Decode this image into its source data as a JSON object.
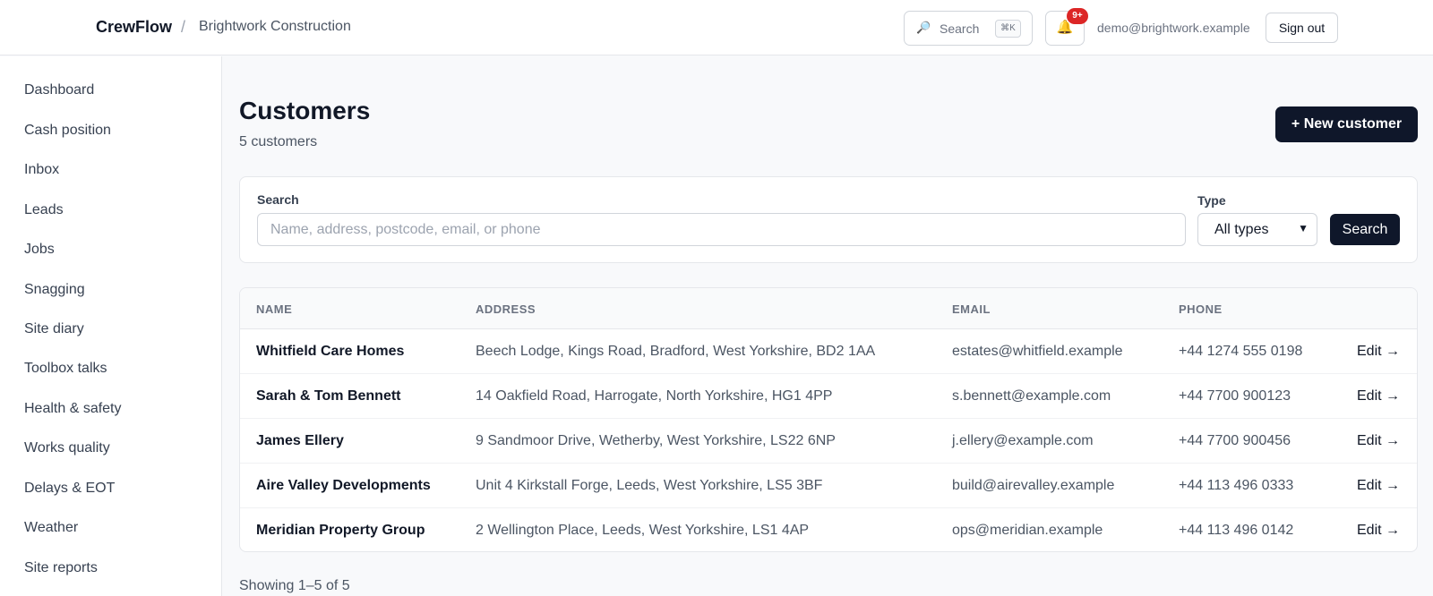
{
  "header": {
    "brand": "CrewFlow",
    "separator": "/",
    "org": "Brightwork Construction",
    "search_label": "Search",
    "search_shortcut": "⌘K",
    "notifications_badge": "9+",
    "user_email": "demo@brightwork.example",
    "signout_label": "Sign out"
  },
  "sidebar": {
    "items": [
      {
        "label": "Dashboard"
      },
      {
        "label": "Cash position"
      },
      {
        "label": "Inbox"
      },
      {
        "label": "Leads"
      },
      {
        "label": "Jobs"
      },
      {
        "label": "Snagging"
      },
      {
        "label": "Site diary"
      },
      {
        "label": "Toolbox talks"
      },
      {
        "label": "Health & safety"
      },
      {
        "label": "Works quality"
      },
      {
        "label": "Delays & EOT"
      },
      {
        "label": "Weather"
      },
      {
        "label": "Site reports"
      }
    ]
  },
  "page": {
    "title": "Customers",
    "subtitle": "5 customers",
    "new_button": "+ New customer"
  },
  "filters": {
    "search_label": "Search",
    "search_placeholder": "Name, address, postcode, email, or phone",
    "type_label": "Type",
    "type_value": "All types",
    "search_button": "Search"
  },
  "table": {
    "columns": [
      "NAME",
      "ADDRESS",
      "EMAIL",
      "PHONE"
    ],
    "rows": [
      {
        "name": "Whitfield Care Homes",
        "address": "Beech Lodge, Kings Road, Bradford, West Yorkshire, BD2 1AA",
        "email": "estates@whitfield.example",
        "phone": "+44 1274 555 0198",
        "action": "Edit →"
      },
      {
        "name": "Sarah & Tom Bennett",
        "address": "14 Oakfield Road, Harrogate, North Yorkshire, HG1 4PP",
        "email": "s.bennett@example.com",
        "phone": "+44 7700 900123",
        "action": "Edit →"
      },
      {
        "name": "James Ellery",
        "address": "9 Sandmoor Drive, Wetherby, West Yorkshire, LS22 6NP",
        "email": "j.ellery@example.com",
        "phone": "+44 7700 900456",
        "action": "Edit →"
      },
      {
        "name": "Aire Valley Developments",
        "address": "Unit 4 Kirkstall Forge, Leeds, West Yorkshire, LS5 3BF",
        "email": "build@airevalley.example",
        "phone": "+44 113 496 0333",
        "action": "Edit →"
      },
      {
        "name": "Meridian Property Group",
        "address": "2 Wellington Place, Leeds, West Yorkshire, LS1 4AP",
        "email": "ops@meridian.example",
        "phone": "+44 113 496 0142",
        "action": "Edit →"
      }
    ]
  },
  "pagination": {
    "summary": "Showing 1–5 of 5"
  },
  "colors": {
    "primary_dark": "#0f172a",
    "badge_red": "#dc2626"
  },
  "icons": {
    "search": "search-icon",
    "notifications": "bell-icon",
    "select_chevron": "chevron-down-icon"
  }
}
